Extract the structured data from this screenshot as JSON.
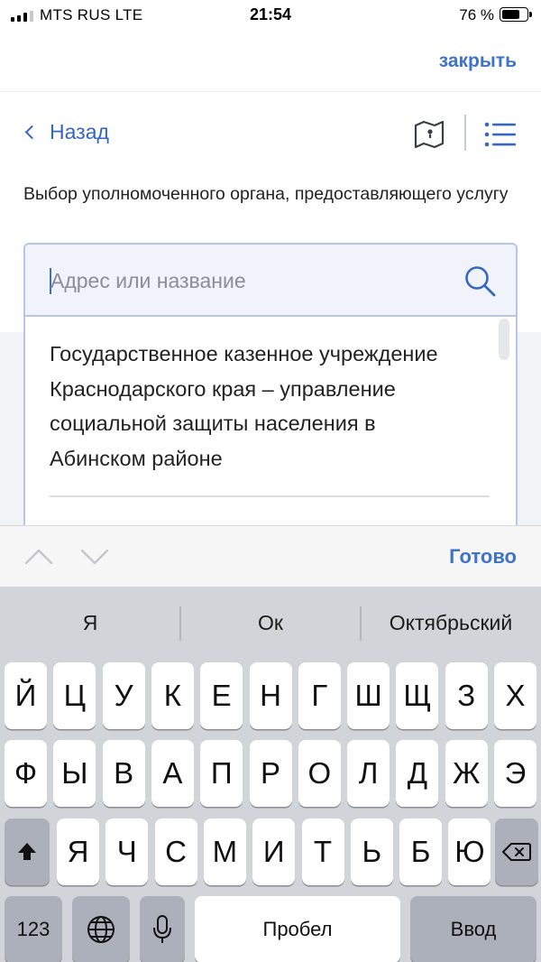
{
  "status_bar": {
    "carrier": "MTS RUS  LTE",
    "time": "21:54",
    "battery_percent_label": "76 %",
    "battery_level": 0.76,
    "signal_bars_active": 3,
    "signal_bars_total": 4
  },
  "modal": {
    "close_label": "закрыть"
  },
  "nav": {
    "back_label": "Назад",
    "map_icon": "map-icon",
    "list_icon": "list-icon"
  },
  "section": {
    "label": "Выбор уполномоченного органа, предоставляющего услугу"
  },
  "search": {
    "placeholder": "Адрес или название",
    "value": ""
  },
  "options": [
    {
      "label": "Государственное казенное учреждение Краснодарского края – управление социальной защиты населения в Абинском районе"
    }
  ],
  "accessory": {
    "done_label": "Готово"
  },
  "keyboard": {
    "suggestions": [
      "Я",
      "Ок",
      "Октябрьский"
    ],
    "row1": [
      "Й",
      "Ц",
      "У",
      "К",
      "Е",
      "Н",
      "Г",
      "Ш",
      "Щ",
      "З",
      "Х"
    ],
    "row2": [
      "Ф",
      "Ы",
      "В",
      "А",
      "П",
      "Р",
      "О",
      "Л",
      "Д",
      "Ж",
      "Э"
    ],
    "row3": [
      "Я",
      "Ч",
      "С",
      "М",
      "И",
      "Т",
      "Ь",
      "Б",
      "Ю"
    ],
    "numbers_label": "123",
    "space_label": "Пробел",
    "return_label": "Ввод"
  },
  "colors": {
    "accent": "#3f72c9",
    "link": "#3566c4",
    "keyboard_bg": "#d1d4d9"
  }
}
